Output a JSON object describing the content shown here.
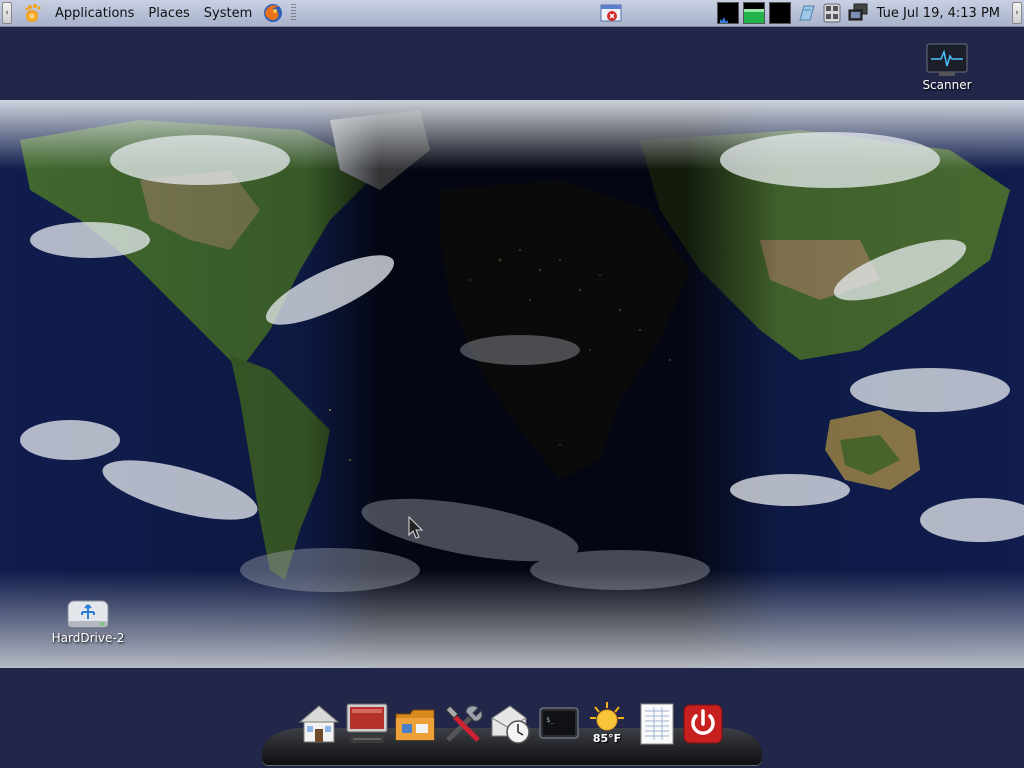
{
  "top_panel": {
    "left_hide_arrow": "‹",
    "right_hide_arrow": "›",
    "menus": [
      "Applications",
      "Places",
      "System"
    ],
    "clock": "Tue Jul 19,  4:13 PM",
    "icons": {
      "main_menu": "gnome-foot-icon",
      "browser": "firefox-icon",
      "center_launcher": "window-close-launcher-icon",
      "applets": [
        "cpu-graph-icon",
        "memory-graph-icon",
        "network-graph-icon",
        "notes-icon",
        "calculator-icon",
        "network-manager-icon"
      ]
    }
  },
  "desktop": {
    "icons": [
      {
        "label": "Scanner",
        "icon": "scanner-monitor-icon"
      },
      {
        "label": "HardDrive-2",
        "icon": "usb-drive-icon"
      }
    ]
  },
  "dock": {
    "items": [
      {
        "name": "home-folder",
        "icon": "house-icon"
      },
      {
        "name": "computer",
        "icon": "computer-icon"
      },
      {
        "name": "file-manager",
        "icon": "folder-icon"
      },
      {
        "name": "system-tools",
        "icon": "tools-icon"
      },
      {
        "name": "mail-clock",
        "icon": "mail-clock-icon"
      },
      {
        "name": "terminal",
        "icon": "terminal-icon"
      },
      {
        "name": "weather",
        "icon": "sun-icon",
        "label": "85°F"
      },
      {
        "name": "text-editor",
        "icon": "document-icon"
      },
      {
        "name": "shutdown",
        "icon": "power-icon"
      }
    ]
  },
  "colors": {
    "panel": "#b9c1d8",
    "desktop_bg": "#222648",
    "ocean": "#0d1a4a",
    "land": "#3f6a2c",
    "night_land": "#1c1c1c",
    "cloud": "#e6e9ef",
    "power_red": "#c8201f"
  }
}
